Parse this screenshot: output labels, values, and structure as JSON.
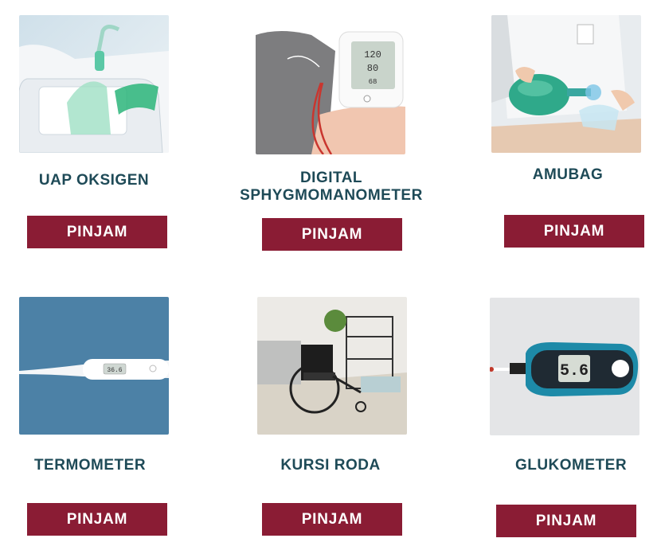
{
  "items": [
    {
      "name": "UAP OKSIGEN",
      "button": "PINJAM"
    },
    {
      "name": "DIGITAL SPHYGMOMANOMETER",
      "button": "PINJAM"
    },
    {
      "name": "AMUBAG",
      "button": "PINJAM"
    },
    {
      "name": "TERMOMETER",
      "button": "PINJAM"
    },
    {
      "name": "KURSI RODA",
      "button": "PINJAM"
    },
    {
      "name": "GLUKOMETER",
      "button": "PINJAM"
    }
  ],
  "glucometer_reading": "5.6",
  "colors": {
    "button_bg": "#8a1c34",
    "title": "#1e4a57",
    "background": "#ffffff"
  },
  "icons": [
    "nebulizer-photo",
    "blood-pressure-monitor-photo",
    "ambu-bag-photo",
    "thermometer-photo",
    "wheelchair-photo",
    "glucometer-photo"
  ]
}
